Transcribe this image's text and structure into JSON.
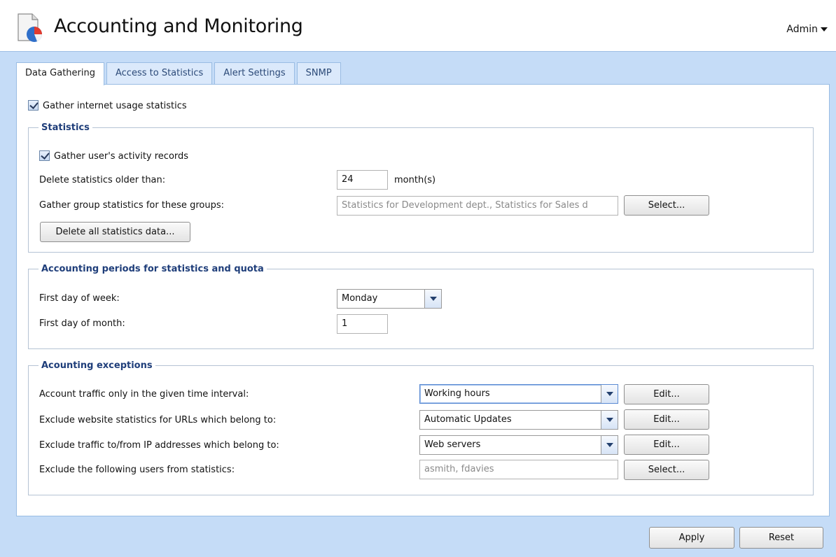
{
  "app": {
    "title": "Accounting and Monitoring",
    "user_menu": "Admin"
  },
  "tabs": [
    {
      "label": "Data Gathering",
      "active": true
    },
    {
      "label": "Access to Statistics",
      "active": false
    },
    {
      "label": "Alert Settings",
      "active": false
    },
    {
      "label": "SNMP",
      "active": false
    }
  ],
  "gather": {
    "label": "Gather internet usage statistics",
    "checked": true
  },
  "statistics": {
    "legend": "Statistics",
    "activity": {
      "label": "Gather user's activity records",
      "checked": true
    },
    "delete_older_label": "Delete statistics older than:",
    "delete_older_value": "24",
    "delete_older_unit": "month(s)",
    "groups_label": "Gather group statistics for these groups:",
    "groups_value": "Statistics for Development dept., Statistics for Sales d",
    "groups_button": "Select...",
    "delete_all_button": "Delete all statistics data..."
  },
  "periods": {
    "legend": "Accounting periods for statistics and quota",
    "week_label": "First day of week:",
    "week_value": "Monday",
    "month_label": "First day of month:",
    "month_value": "1"
  },
  "exceptions": {
    "legend": "Acounting exceptions",
    "rows": [
      {
        "label": "Account traffic only in the given time interval:",
        "value": "Working hours",
        "button": "Edit..."
      },
      {
        "label": "Exclude website statistics for URLs which belong to:",
        "value": "Automatic Updates",
        "button": "Edit..."
      },
      {
        "label": "Exclude traffic to/from IP addresses which belong to:",
        "value": "Web servers",
        "button": "Edit..."
      },
      {
        "label": "Exclude the following users from statistics:",
        "value": "asmith, fdavies",
        "button": "Select..."
      }
    ]
  },
  "footer": {
    "apply": "Apply",
    "reset": "Reset"
  }
}
